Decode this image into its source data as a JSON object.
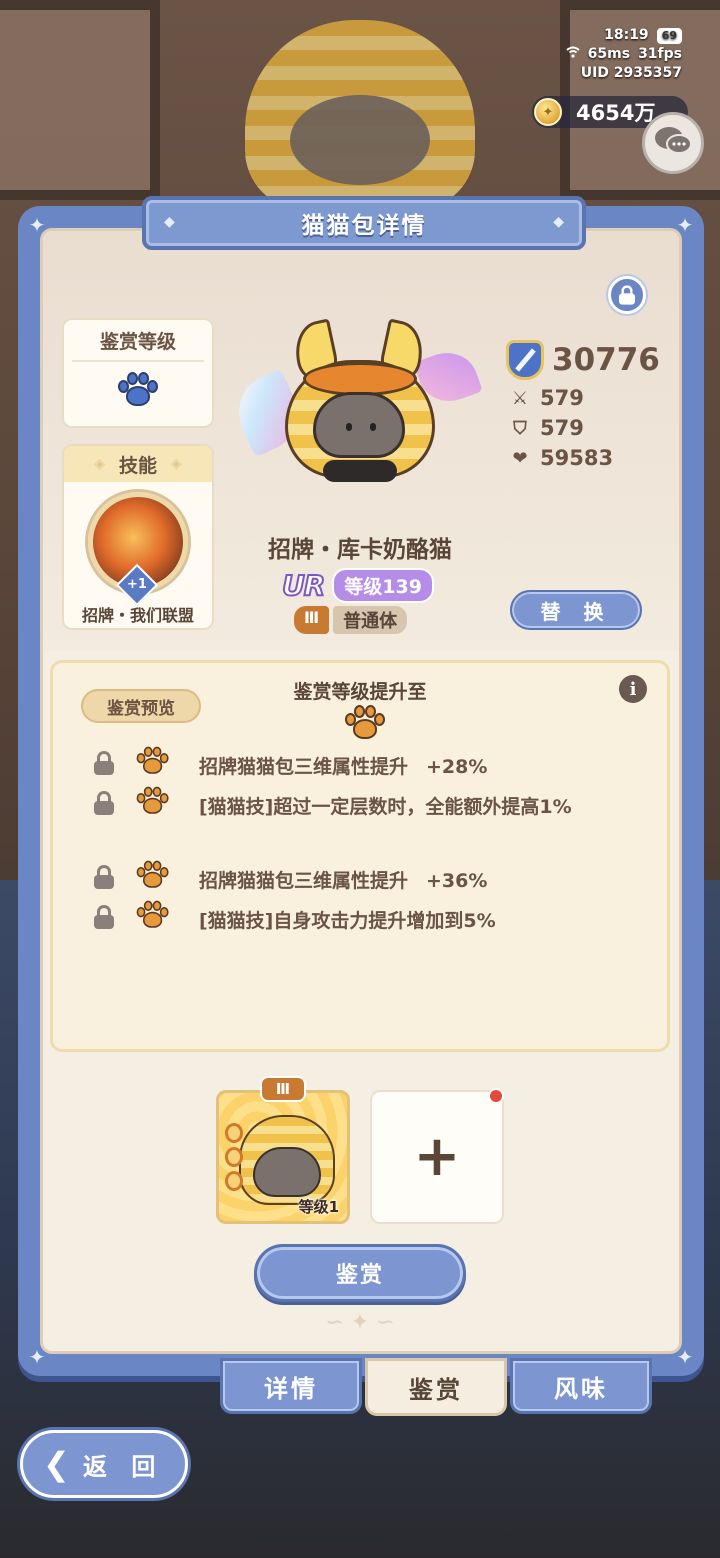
{
  "status_bar": {
    "time": "18:19",
    "battery": "69",
    "ping": "65ms",
    "fps": "31fps",
    "uid": "UID 2935357"
  },
  "currency": {
    "value": "4654万",
    "icon": "coin-icon"
  },
  "chat": {
    "icon": "chat-bubbles-icon"
  },
  "panel": {
    "title": "猫猫包详情"
  },
  "appraisal_level": {
    "title": "鉴赏等级",
    "icon": "blue-paw-icon"
  },
  "skill": {
    "title": "技能",
    "badge": "+1",
    "name": "招牌・我们联盟"
  },
  "cat": {
    "name": "招牌・库卡奶酪猫",
    "rarity": "UR",
    "level": "等级139",
    "tier": "Ⅲ",
    "type": "普通体",
    "replace_label": "替 换"
  },
  "stats": {
    "power": "30776",
    "attack": "579",
    "defense": "579",
    "hp": "59583"
  },
  "effects": {
    "title": "鉴赏等级提升至",
    "preview_label": "鉴赏预览",
    "info_icon": "i",
    "rows": [
      {
        "text": "招牌猫猫包三维属性提升",
        "value": "+28%",
        "paw": "orange-paw-icon"
      },
      {
        "text": "[猫猫技]超过一定层数时，全能额外提高1%",
        "value": "",
        "paw": "orange-paw-icon"
      },
      {
        "text": "招牌猫猫包三维属性提升",
        "value": "+36%",
        "paw": "orange-paw-icon"
      },
      {
        "text": "[猫猫技]自身攻击力提升增加到5%",
        "value": "",
        "paw": "orange-paw-icon"
      }
    ]
  },
  "slots": {
    "cat_tier": "Ⅲ",
    "cat_level": "等级1",
    "empty_icon": "+"
  },
  "appraise_button": "鉴赏",
  "tabs": [
    {
      "label": "详情",
      "active": false
    },
    {
      "label": "鉴赏",
      "active": true
    },
    {
      "label": "风味",
      "active": false
    }
  ],
  "back_button": "返 回",
  "colors": {
    "panel_blue": "#6b86c4",
    "cream": "#f5eee2",
    "text_brown": "#5a4638",
    "ur_purple": "#b58de8",
    "paw_orange": "#e79a3b",
    "paw_blue": "#4d73c9"
  }
}
